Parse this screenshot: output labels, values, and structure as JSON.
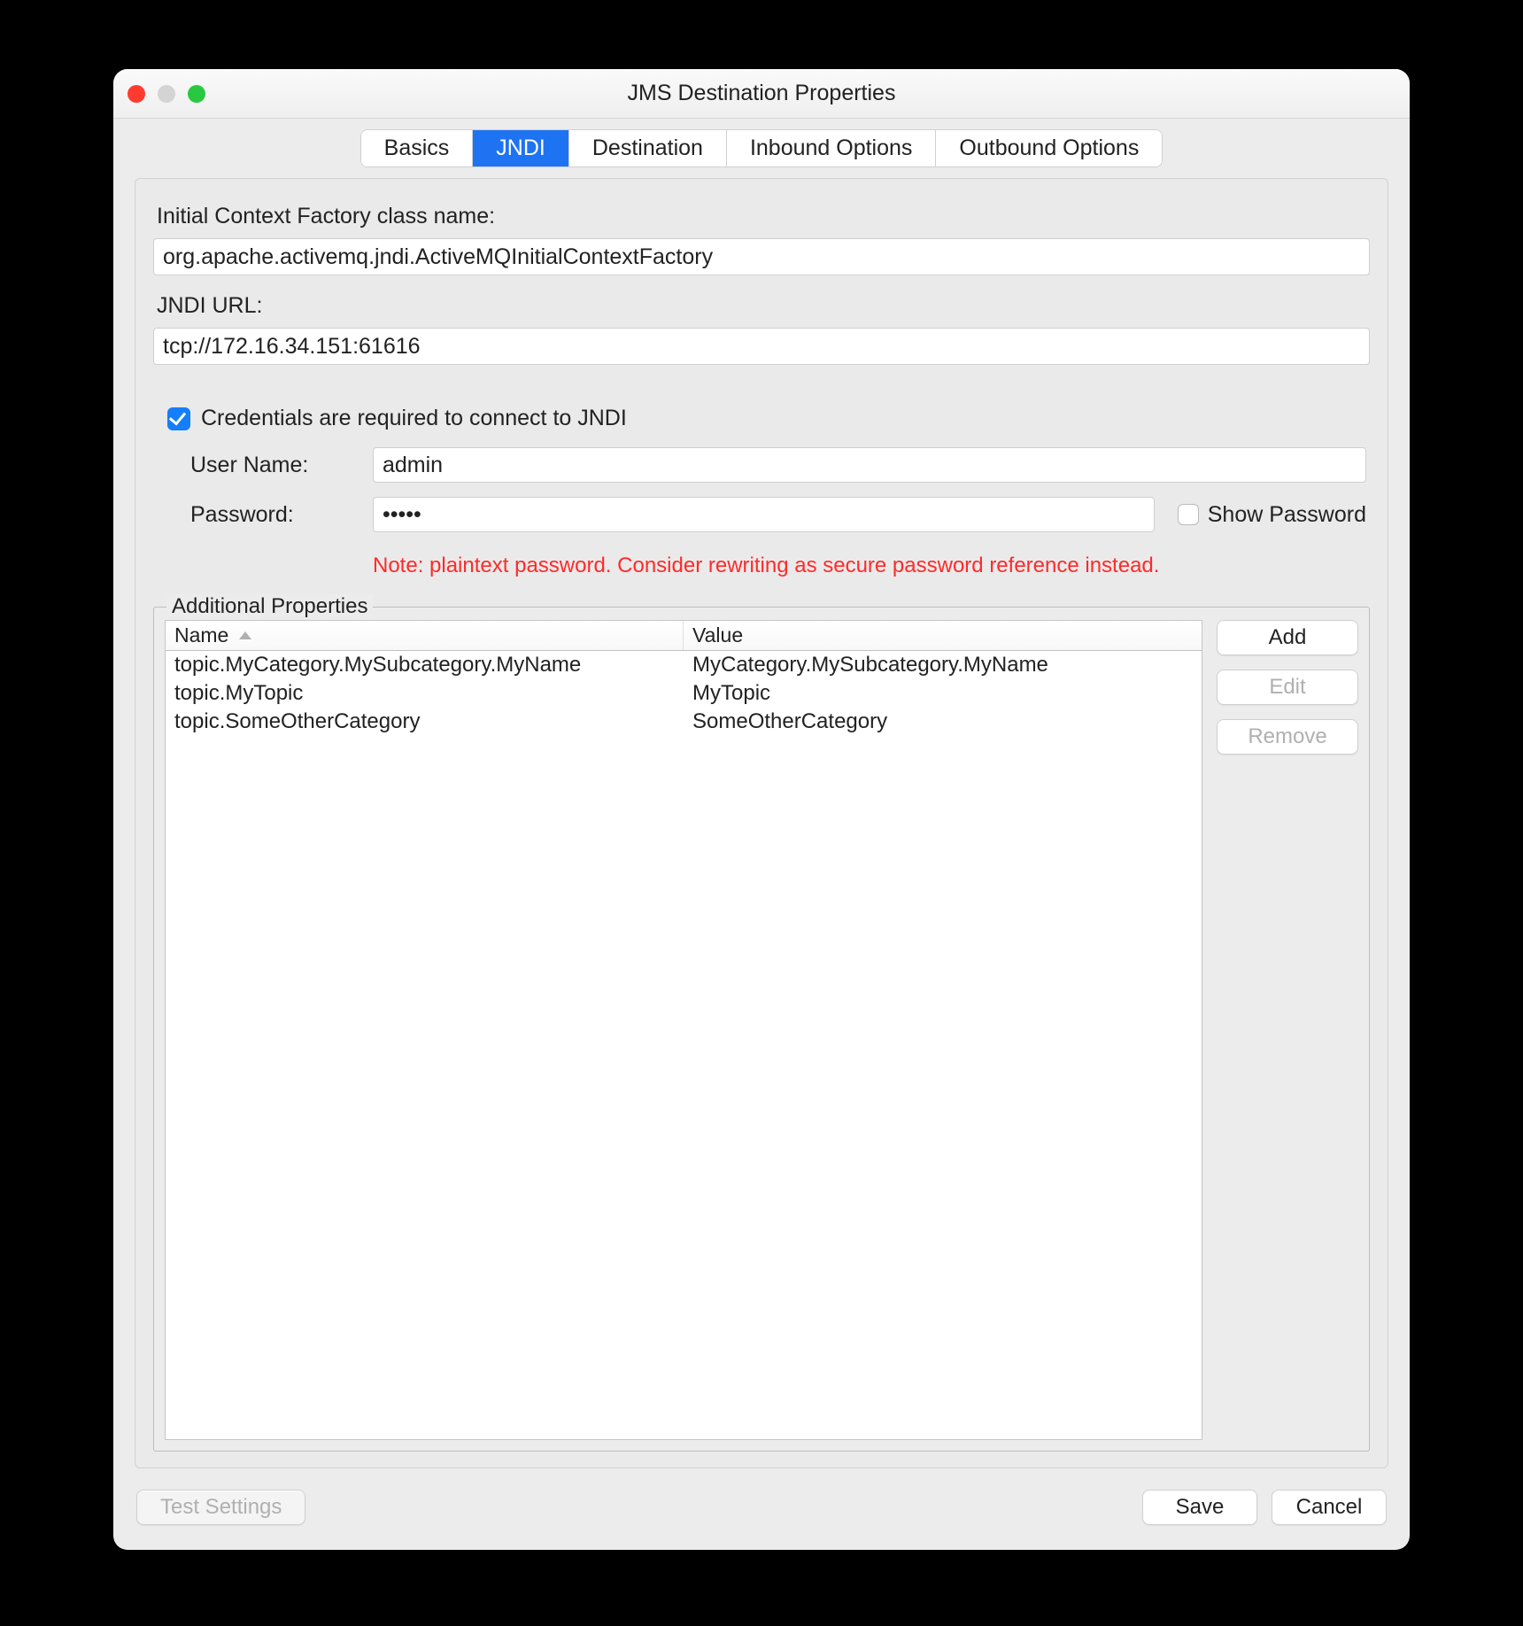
{
  "window": {
    "title": "JMS Destination Properties"
  },
  "tabs": {
    "basics": "Basics",
    "jndi": "JNDI",
    "destination": "Destination",
    "inbound": "Inbound Options",
    "outbound": "Outbound Options",
    "selected": "jndi"
  },
  "jndi": {
    "context_label": "Initial Context Factory class name:",
    "context_value": "org.apache.activemq.jndi.ActiveMQInitialContextFactory",
    "url_label": "JNDI URL:",
    "url_value": "tcp://172.16.34.151:61616",
    "creds_checkbox_label": "Credentials are required to connect to JNDI",
    "creds_checked": true,
    "username_label": "User Name:",
    "username_value": "admin",
    "password_label": "Password:",
    "password_value": "•••••",
    "show_password_label": "Show Password",
    "note": "Note: plaintext password. Consider rewriting as secure password reference instead."
  },
  "additional_properties": {
    "legend": "Additional Properties",
    "columns": {
      "name": "Name",
      "value": "Value"
    },
    "sort_column": "name",
    "sort_direction": "asc",
    "rows": [
      {
        "name": "topic.MyCategory.MySubcategory.MyName",
        "value": "MyCategory.MySubcategory.MyName"
      },
      {
        "name": "topic.MyTopic",
        "value": "MyTopic"
      },
      {
        "name": "topic.SomeOtherCategory",
        "value": "SomeOtherCategory"
      }
    ],
    "buttons": {
      "add": "Add",
      "edit": "Edit",
      "remove": "Remove"
    }
  },
  "footer": {
    "test_settings": "Test Settings",
    "save": "Save",
    "cancel": "Cancel"
  }
}
